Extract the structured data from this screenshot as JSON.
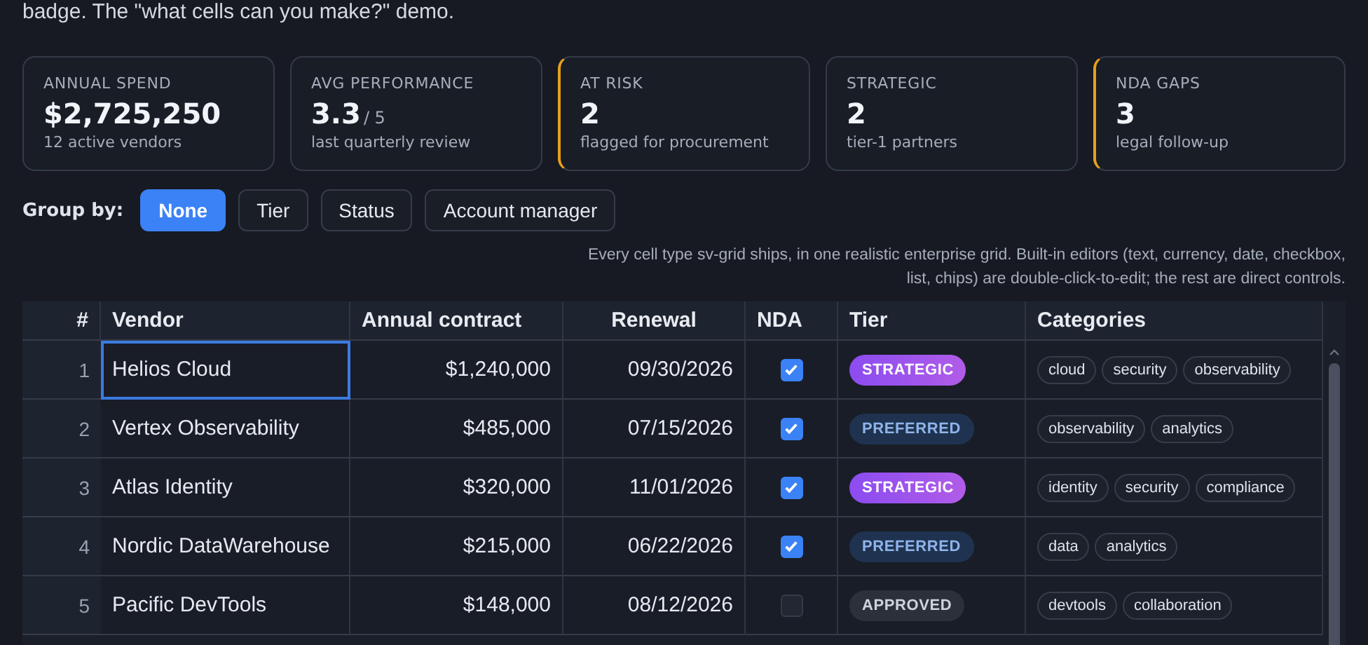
{
  "intro": "badge. The \"what cells can you make?\" demo.",
  "stats": [
    {
      "label": "ANNUAL SPEND",
      "value": "$2,725,250",
      "note": "12 active vendors",
      "flagged": false
    },
    {
      "label": "AVG PERFORMANCE",
      "value": "3.3",
      "suffix": "/ 5",
      "note": "last quarterly review",
      "flagged": false
    },
    {
      "label": "AT RISK",
      "value": "2",
      "note": "flagged for procurement",
      "flagged": true
    },
    {
      "label": "STRATEGIC",
      "value": "2",
      "note": "tier-1 partners",
      "flagged": false
    },
    {
      "label": "NDA GAPS",
      "value": "3",
      "note": "legal follow-up",
      "flagged": true
    }
  ],
  "group_by": {
    "label": "Group by:",
    "options": [
      {
        "label": "None",
        "selected": true
      },
      {
        "label": "Tier",
        "selected": false
      },
      {
        "label": "Status",
        "selected": false
      },
      {
        "label": "Account manager",
        "selected": false
      }
    ]
  },
  "description": "Every cell type sv-grid ships, in one realistic enterprise grid. Built-in editors (text, currency, date, checkbox, list, chips) are double-click-to-edit; the rest are direct controls.",
  "table": {
    "columns": [
      "#",
      "Vendor",
      "Annual contract",
      "Renewal",
      "NDA",
      "Tier",
      "Categories"
    ],
    "rows": [
      {
        "index": "1",
        "vendor": "Helios Cloud",
        "focused": true,
        "contract": "$1,240,000",
        "renewal": "09/30/2026",
        "nda": true,
        "tier": {
          "label": "STRATEGIC",
          "kind": "strategic"
        },
        "categories": [
          "cloud",
          "security",
          "observability"
        ]
      },
      {
        "index": "2",
        "vendor": "Vertex Observability",
        "focused": false,
        "contract": "$485,000",
        "renewal": "07/15/2026",
        "nda": true,
        "tier": {
          "label": "PREFERRED",
          "kind": "preferred"
        },
        "categories": [
          "observability",
          "analytics"
        ]
      },
      {
        "index": "3",
        "vendor": "Atlas Identity",
        "focused": false,
        "contract": "$320,000",
        "renewal": "11/01/2026",
        "nda": true,
        "tier": {
          "label": "STRATEGIC",
          "kind": "strategic"
        },
        "categories": [
          "identity",
          "security",
          "compliance"
        ]
      },
      {
        "index": "4",
        "vendor": "Nordic DataWarehouse",
        "focused": false,
        "contract": "$215,000",
        "renewal": "06/22/2026",
        "nda": true,
        "tier": {
          "label": "PREFERRED",
          "kind": "preferred"
        },
        "categories": [
          "data",
          "analytics"
        ]
      },
      {
        "index": "5",
        "vendor": "Pacific DevTools",
        "focused": false,
        "contract": "$148,000",
        "renewal": "08/12/2026",
        "nda": false,
        "tier": {
          "label": "APPROVED",
          "kind": "approved"
        },
        "categories": [
          "devtools",
          "collaboration"
        ]
      }
    ]
  }
}
